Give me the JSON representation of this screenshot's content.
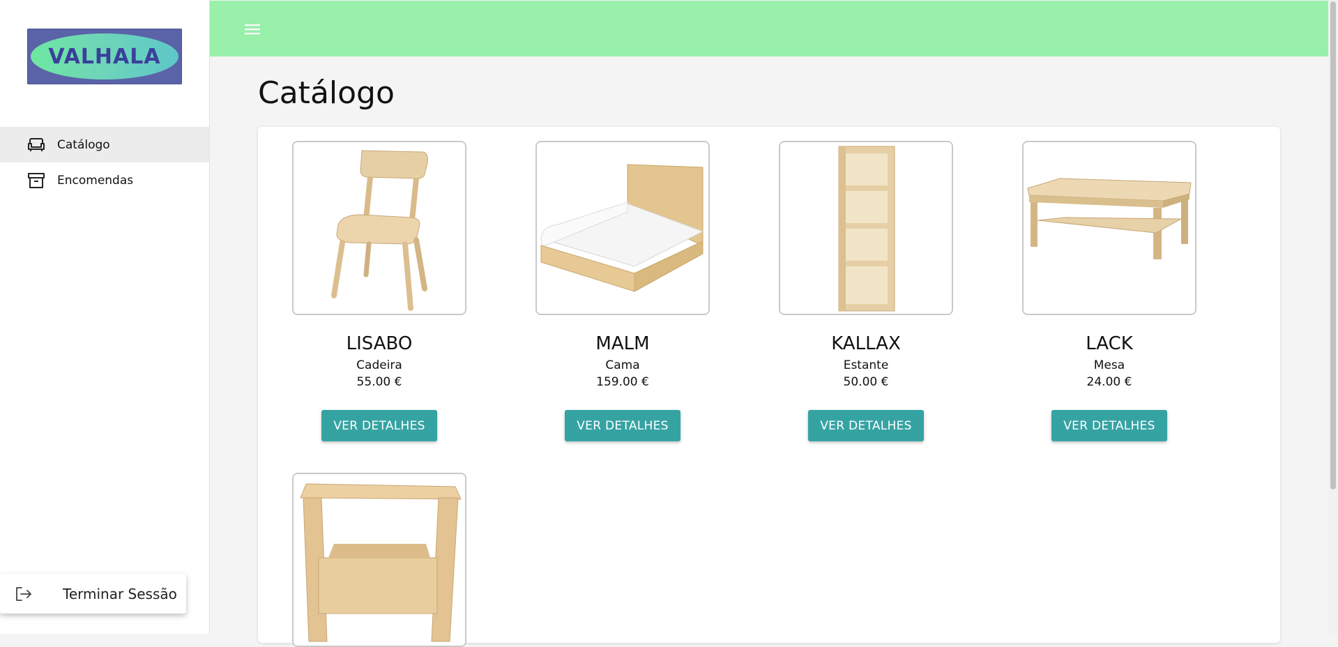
{
  "brand": {
    "logo_text": "VALHALA"
  },
  "sidebar": {
    "items": [
      {
        "label": "Catálogo",
        "icon": "sofa-icon",
        "active": true
      },
      {
        "label": "Encomendas",
        "icon": "archive-box-icon",
        "active": false
      }
    ],
    "logout_label": "Terminar Sessão",
    "logout_icon": "logout-icon"
  },
  "topbar": {
    "menu_icon": "hamburger-menu-icon",
    "color": "#98f0ab"
  },
  "main": {
    "title": "Catálogo",
    "products": [
      {
        "name": "LISABO",
        "type": "Cadeira",
        "price": "55.00 €",
        "button": "VER DETALHES",
        "image": "chair"
      },
      {
        "name": "MALM",
        "type": "Cama",
        "price": "159.00 €",
        "button": "VER DETALHES",
        "image": "bed"
      },
      {
        "name": "KALLAX",
        "type": "Estante",
        "price": "50.00 €",
        "button": "VER DETALHES",
        "image": "shelf"
      },
      {
        "name": "LACK",
        "type": "Mesa",
        "price": "24.00 €",
        "button": "VER DETALHES",
        "image": "table"
      },
      {
        "name": "",
        "type": "",
        "price": "",
        "button": "",
        "image": "stool"
      }
    ]
  },
  "colors": {
    "accent": "#36a3a3",
    "topbar": "#98f0ab",
    "logo_bg": "#5a63a8"
  }
}
